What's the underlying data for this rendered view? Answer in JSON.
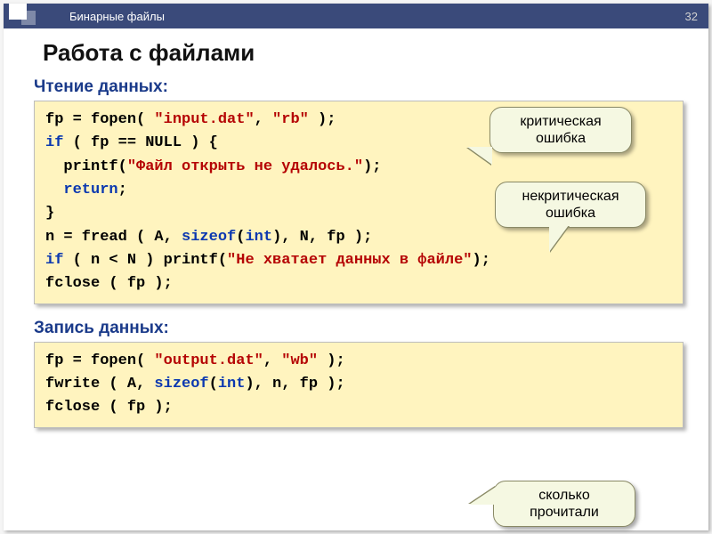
{
  "slide": {
    "breadcrumb": "Бинарные файлы",
    "page_number": "32",
    "title": "Работа с файлами"
  },
  "sections": {
    "read": {
      "heading": "Чтение данных:",
      "code_plain": "fp = fopen( \"input.dat\", \"rb\" );\nif ( fp == NULL ) {\n  printf(\"Файл открыть не удалось.\");\n  return;\n}\nn = fread ( A, sizeof(int), N, fp );\nif ( n < N ) printf(\"Не хватает данных в файле\");\nfclose ( fp );",
      "tokens": {
        "l1a": "fp = fopen( ",
        "l1s1": "\"input.dat\"",
        "l1b": ", ",
        "l1s2": "\"rb\"",
        "l1c": " );",
        "l2a": "if",
        "l2b": " ( fp == NULL ) {",
        "l3a": "  printf(",
        "l3s": "\"Файл открыть не удалось.\"",
        "l3b": ");",
        "l4a": "  ",
        "l4k": "return",
        "l4b": ";",
        "l5": "}",
        "l6a": "n = fread ( A, ",
        "l6k1": "sizeof",
        "l6b": "(",
        "l6k2": "int",
        "l6c": "), N, fp );",
        "l7a": "if",
        "l7b": " ( n < N ) printf(",
        "l7s": "\"Не хватает данных в файле\"",
        "l7c": ");",
        "l8": "fclose ( fp );"
      }
    },
    "write": {
      "heading": "Запись данных:",
      "code_plain": "fp = fopen( \"output.dat\", \"wb\" );\nfwrite ( A, sizeof(int), n, fp );\nfclose ( fp );",
      "tokens": {
        "l1a": "fp = fopen( ",
        "l1s1": "\"output.dat\"",
        "l1b": ", ",
        "l1s2": "\"wb\"",
        "l1c": " );",
        "l2a": "fwrite ( A, ",
        "l2k1": "sizeof",
        "l2b": "(",
        "l2k2": "int",
        "l2c": "), n, fp );",
        "l3": "fclose ( fp );"
      }
    }
  },
  "callouts": {
    "c1": "критическая ошибка",
    "c2": "некритическая ошибка",
    "c3": "сколько прочитали"
  }
}
